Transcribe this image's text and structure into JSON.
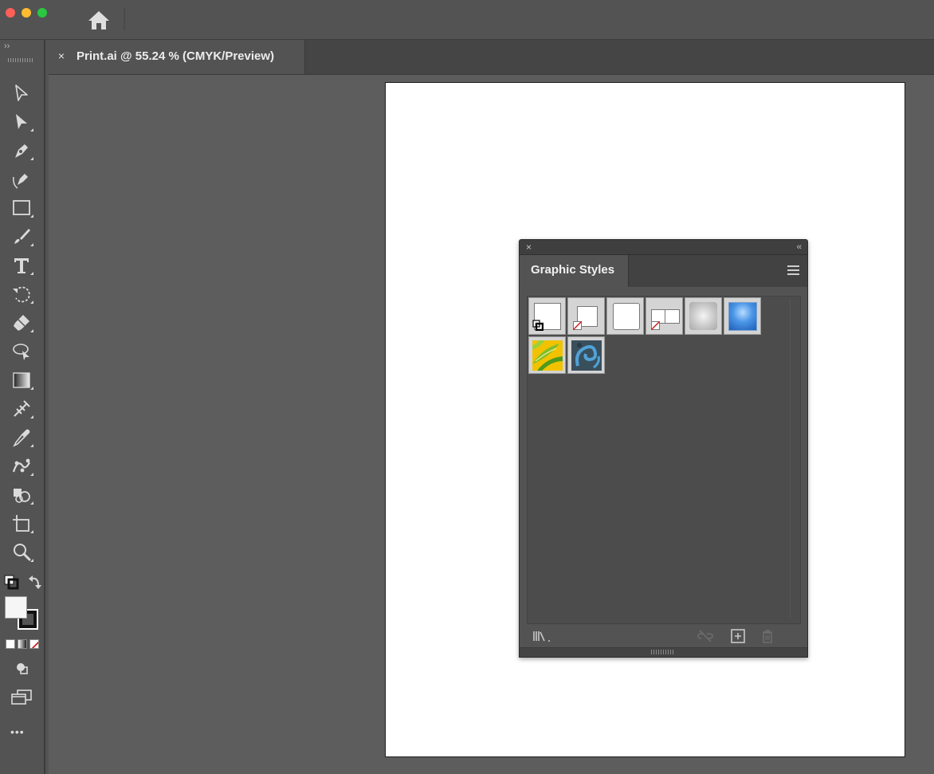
{
  "window": {
    "title_icons": [
      "close-dot",
      "minimize-dot",
      "maximize-dot",
      "home-icon"
    ]
  },
  "document_tab": {
    "close_glyph": "×",
    "title": "Print.ai @ 55.24 % (CMYK/Preview)"
  },
  "toolbar": {
    "collapse_glyph": "››",
    "more_glyph": "•••",
    "tools": [
      "selection-tool",
      "direct-selection-tool",
      "pen-tool",
      "curvature-tool",
      "rectangle-tool",
      "paintbrush-tool",
      "type-tool",
      "rotate-tool",
      "eraser-tool",
      "lasso-select-tool",
      "gradient-tool",
      "width-tool",
      "eyedropper-tool",
      "puppet-warp-tool",
      "shape-builder-tool",
      "artboard-tool",
      "zoom-tool"
    ]
  },
  "graphic_styles_panel": {
    "close_glyph": "×",
    "collapse_glyph": "‹‹",
    "tab_label": "Graphic Styles",
    "swatches": [
      "default-graphic-style",
      "basic-text-style",
      "default-no-fill-style",
      "no-fill-stroke-style",
      "soft-shadow-style",
      "blue-gradient-style",
      "yellow-leaf-pattern-style",
      "blue-swirl-pattern-style"
    ],
    "footer_buttons": [
      "graphic-styles-libraries",
      "break-link",
      "new-graphic-style",
      "delete-graphic-style"
    ]
  },
  "colors": {
    "chrome": "#535353",
    "canvas": "#5d5d5d",
    "artboard": "#ffffff",
    "accent_blue": "#2f7ad8",
    "none_red": "#cc1f1f"
  }
}
